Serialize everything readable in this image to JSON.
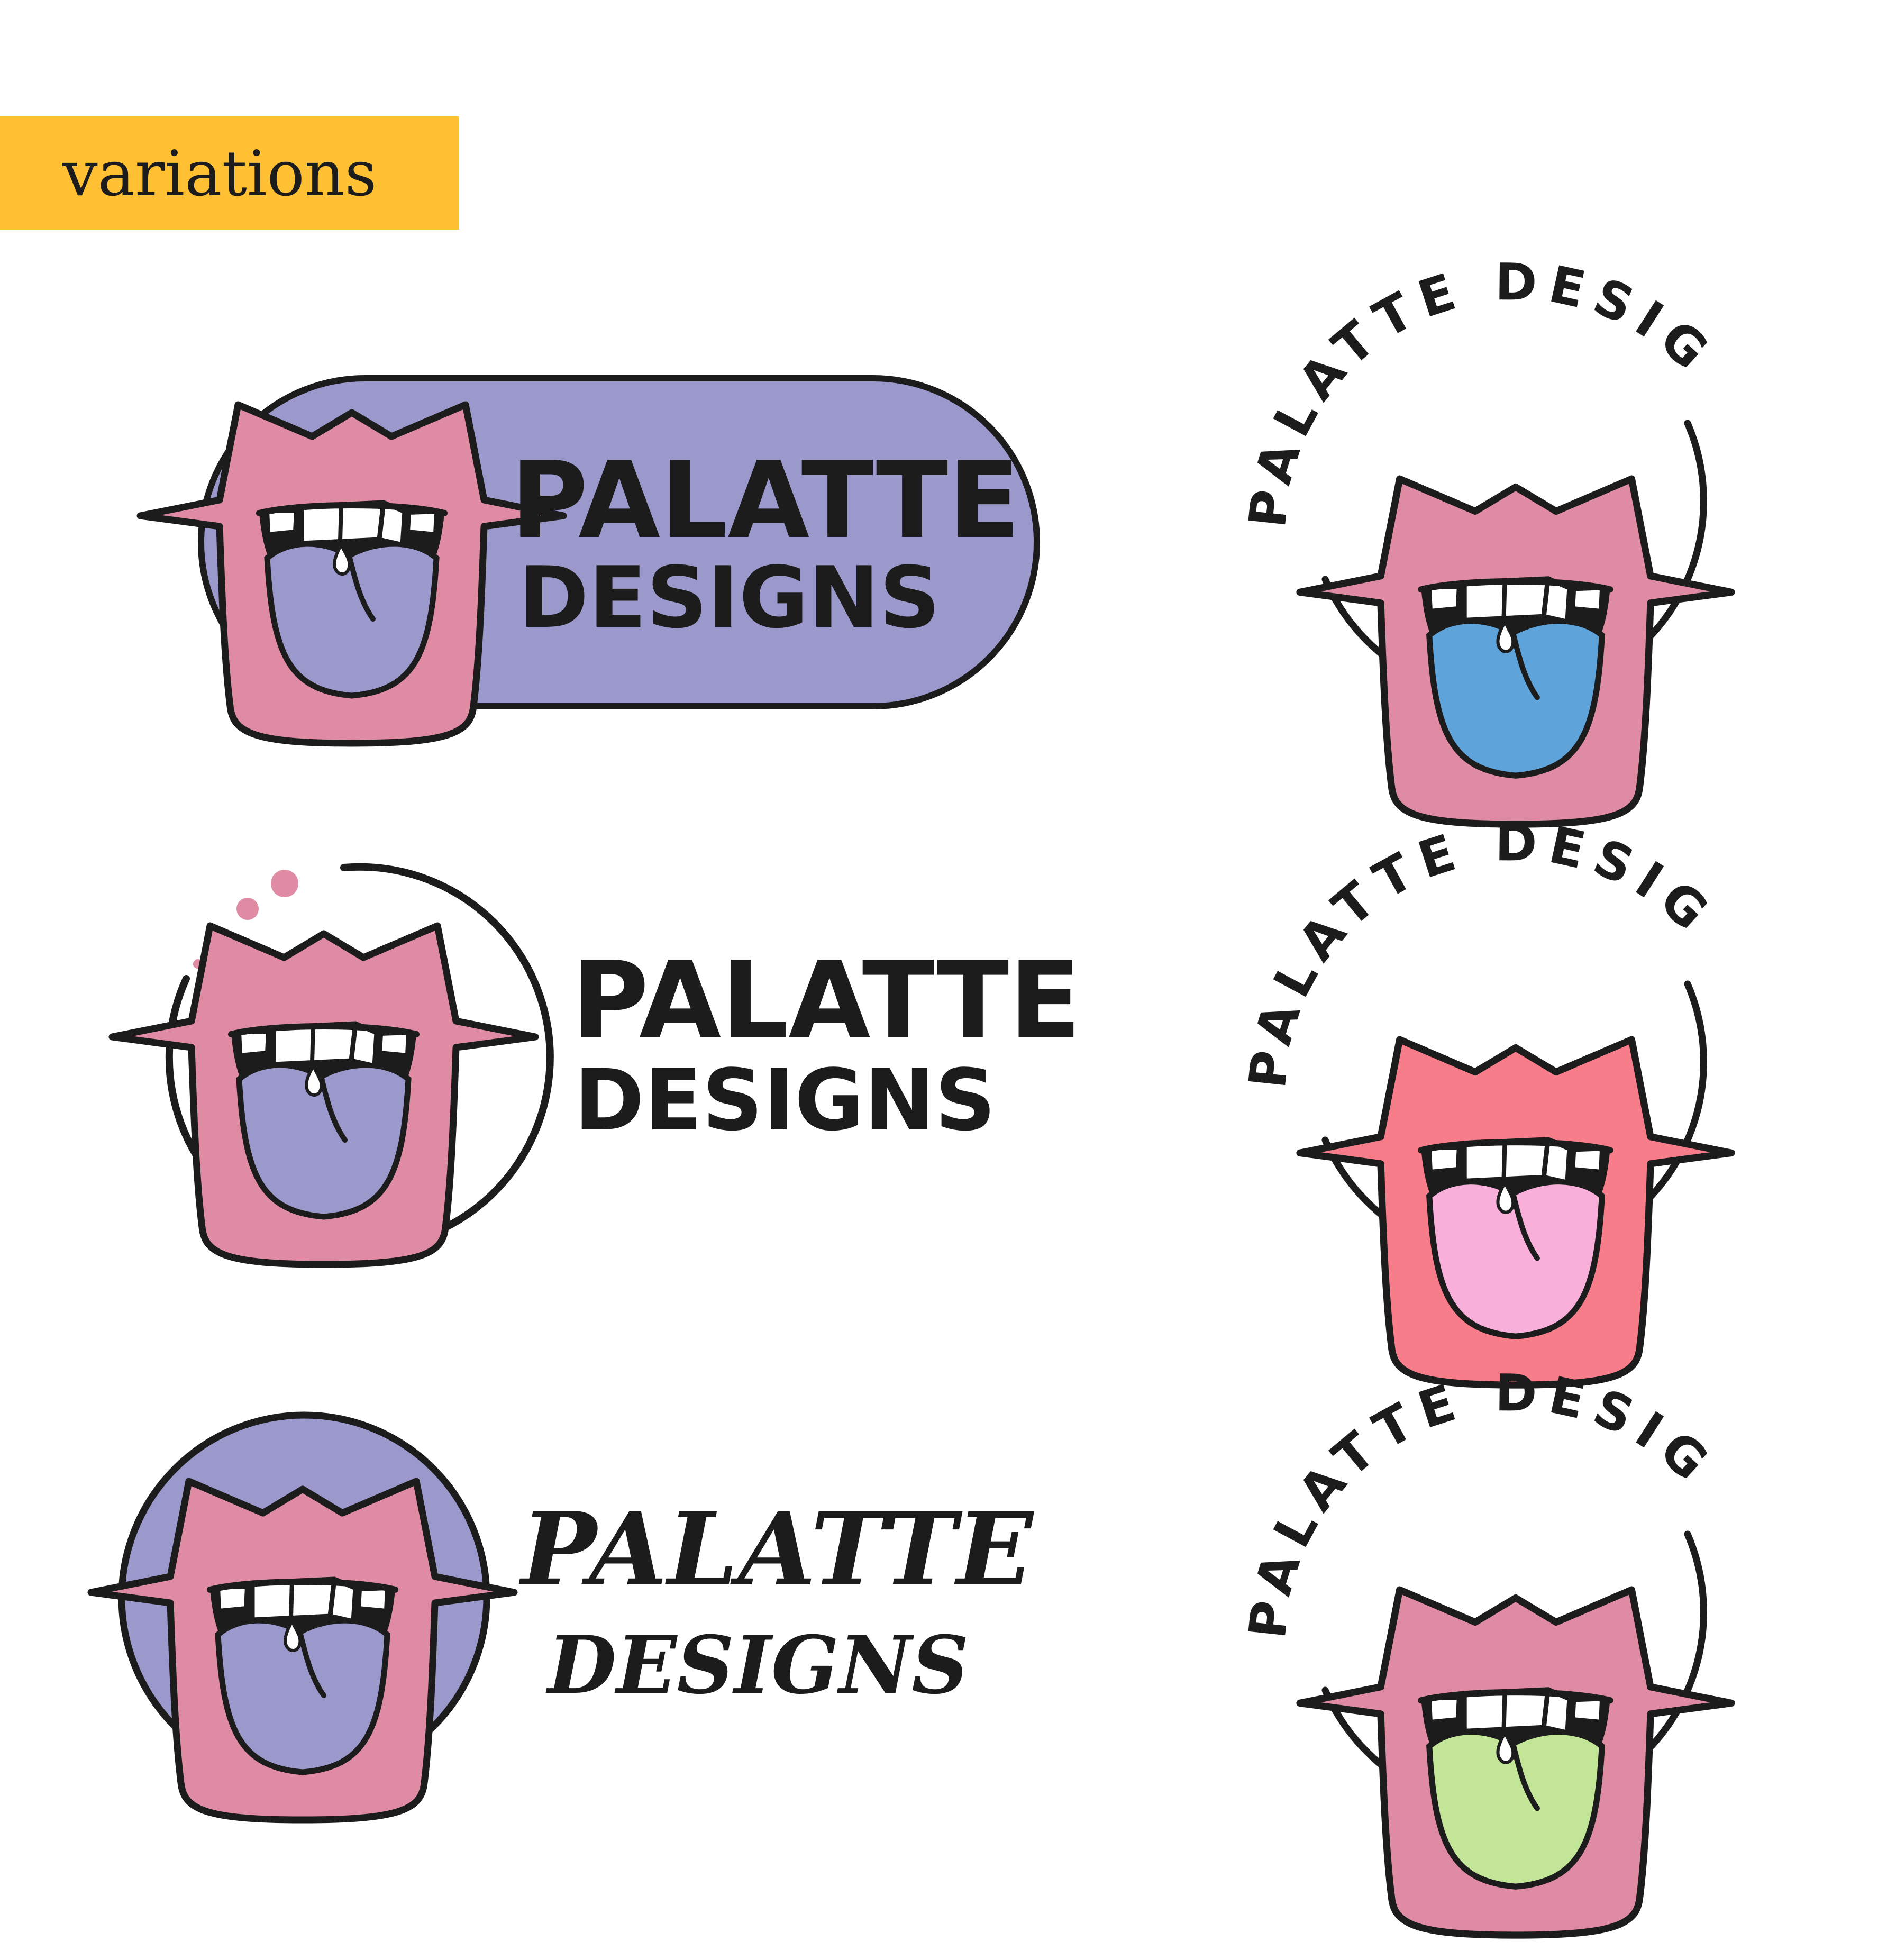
{
  "label": {
    "text": "variations"
  },
  "logos": {
    "pill": {
      "line1": "PALATTE",
      "line2": "DESIGNS"
    },
    "ring": {
      "line1": "PALATTE",
      "line2": "DESIGNS"
    },
    "disc": {
      "line1": "PALATTE",
      "line2": "DESIGNS"
    },
    "badge_arc_text": "PALATTE DESIGNS"
  },
  "colors": {
    "label_bg": "#FFC133",
    "purple": "#9B99CB",
    "lip_pink": "#DE8BA3",
    "outline": "#1C1C1C",
    "coral": "#F77D8A",
    "tongue_blue": "#5FA3DB",
    "tongue_pink": "#F8B0DA",
    "tongue_green": "#C2E597"
  }
}
